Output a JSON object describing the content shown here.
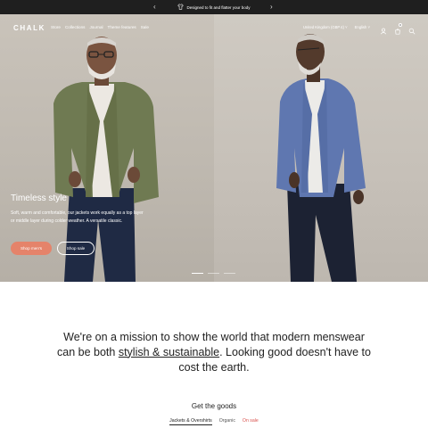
{
  "announcement": {
    "text": "Designed to fit and flatter your body",
    "prev_icon": "chevron-left-icon",
    "next_icon": "chevron-right-icon",
    "icon": "shirt-icon"
  },
  "header": {
    "logo": "CHALK",
    "nav": [
      "Store",
      "Collections",
      "Journal",
      "Theme features",
      "Sale"
    ],
    "country": "United Kingdom (GBP £)",
    "language": "English",
    "cart_count": "0",
    "icons": [
      "account-icon",
      "cart-icon",
      "search-icon"
    ]
  },
  "hero": {
    "title": "Timeless style",
    "text": "Soft, warm and comfortable, our jackets work equally as a top layer or middle layer during colder weather. A versatile classic.",
    "primary_button": "Shop men's",
    "secondary_button": "Shop sale",
    "slides": 3,
    "active_slide": 1
  },
  "mission": {
    "before": "We're on a mission to show the world that modern menswear can be both ",
    "highlight": "stylish & sustainable",
    "after": ". Looking good doesn't have to cost the earth."
  },
  "goods": {
    "title": "Get the goods",
    "tabs": [
      "Jackets & Overshirts",
      "Organic",
      "On sale"
    ]
  },
  "colors": {
    "accent": "#e5836a",
    "sale": "#d9534f",
    "announcement_bg": "#1f1f1f"
  }
}
